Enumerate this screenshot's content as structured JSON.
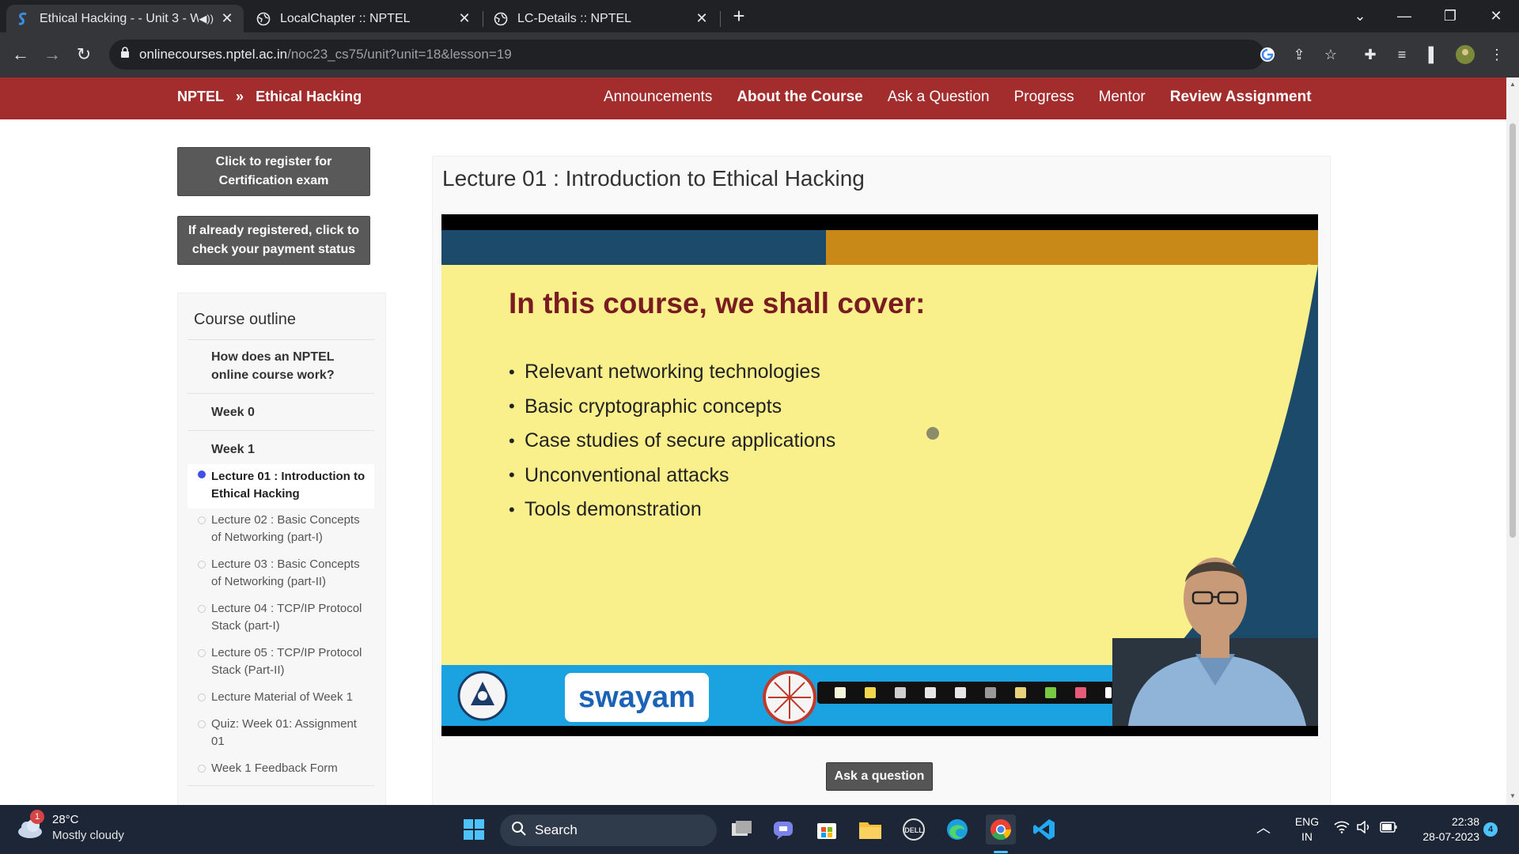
{
  "browser": {
    "tabs": [
      {
        "title": "Ethical Hacking - - Unit 3 - W",
        "active": true
      },
      {
        "title": "LocalChapter :: NPTEL",
        "active": false
      },
      {
        "title": "LC-Details :: NPTEL",
        "active": false
      }
    ],
    "url_host": "onlinecourses.nptel.ac.in",
    "url_path": "/noc23_cs75/unit?unit=18&lesson=19"
  },
  "navbar": {
    "brand": "NPTEL",
    "separator": "»",
    "course": "Ethical Hacking",
    "links": [
      {
        "label": "Announcements",
        "bold": false
      },
      {
        "label": "About the Course",
        "bold": true
      },
      {
        "label": "Ask a Question",
        "bold": false
      },
      {
        "label": "Progress",
        "bold": false
      },
      {
        "label": "Mentor",
        "bold": false
      },
      {
        "label": "Review Assignment",
        "bold": true
      }
    ]
  },
  "sidebar": {
    "register_btn": "Click to register for Certification exam",
    "payment_btn": "If already registered, click to check your payment status",
    "outline_title": "Course outline",
    "items": [
      {
        "label": "How does an NPTEL online course work?"
      },
      {
        "label": "Week 0"
      },
      {
        "label": "Week 1"
      }
    ],
    "lessons": [
      {
        "label": "Lecture 01 : Introduction to Ethical Hacking",
        "active": true
      },
      {
        "label": "Lecture 02 : Basic Concepts of Networking (part-I)",
        "active": false
      },
      {
        "label": "Lecture 03 : Basic Concepts of Networking (part-II)",
        "active": false
      },
      {
        "label": "Lecture 04 : TCP/IP Protocol Stack (part-I)",
        "active": false
      },
      {
        "label": "Lecture 05 : TCP/IP Protocol Stack (Part-II)",
        "active": false
      },
      {
        "label": "Lecture Material of Week 1",
        "active": false
      },
      {
        "label": "Quiz: Week 01: Assignment 01",
        "active": false
      },
      {
        "label": "Week 1 Feedback Form",
        "active": false
      }
    ]
  },
  "main": {
    "lecture_title": "Lecture 01 : Introduction to Ethical Hacking",
    "slide": {
      "heading": "In this course, we shall cover:",
      "bullets": [
        "Relevant networking technologies",
        "Basic cryptographic concepts",
        "Case studies of secure applications",
        "Unconventional attacks",
        "Tools demonstration"
      ],
      "swayam": "swayam"
    },
    "ask_button": "Ask a question"
  },
  "taskbar": {
    "weather_temp": "28°C",
    "weather_desc": "Mostly cloudy",
    "weather_badge": "1",
    "search": "Search",
    "lang_top": "ENG",
    "lang_bottom": "IN",
    "time": "22:38",
    "date": "28-07-2023",
    "notif_count": "4"
  },
  "colors": {
    "nav_red": "#a32d2d",
    "slide_bg": "#f9ef8b",
    "slide_heading": "#7a1b22",
    "active_dot": "#3f51e8"
  }
}
